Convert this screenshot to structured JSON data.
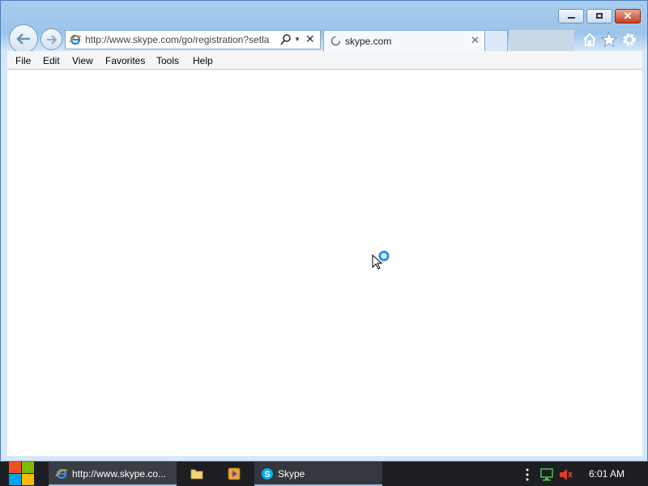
{
  "window": {
    "address_url": "http://www.skype.com/go/registration?setla",
    "tab_title": "skype.com"
  },
  "menu": [
    "File",
    "Edit",
    "View",
    "Favorites",
    "Tools",
    "Help"
  ],
  "taskbar": {
    "ie_task_label": "http://www.skype.co...",
    "skype_task_label": "Skype",
    "clock": "6:01 AM"
  },
  "colors": {
    "taskbar": "#1c1e22",
    "window_frame": "#a9cdee",
    "close_button": "#c63e22"
  }
}
